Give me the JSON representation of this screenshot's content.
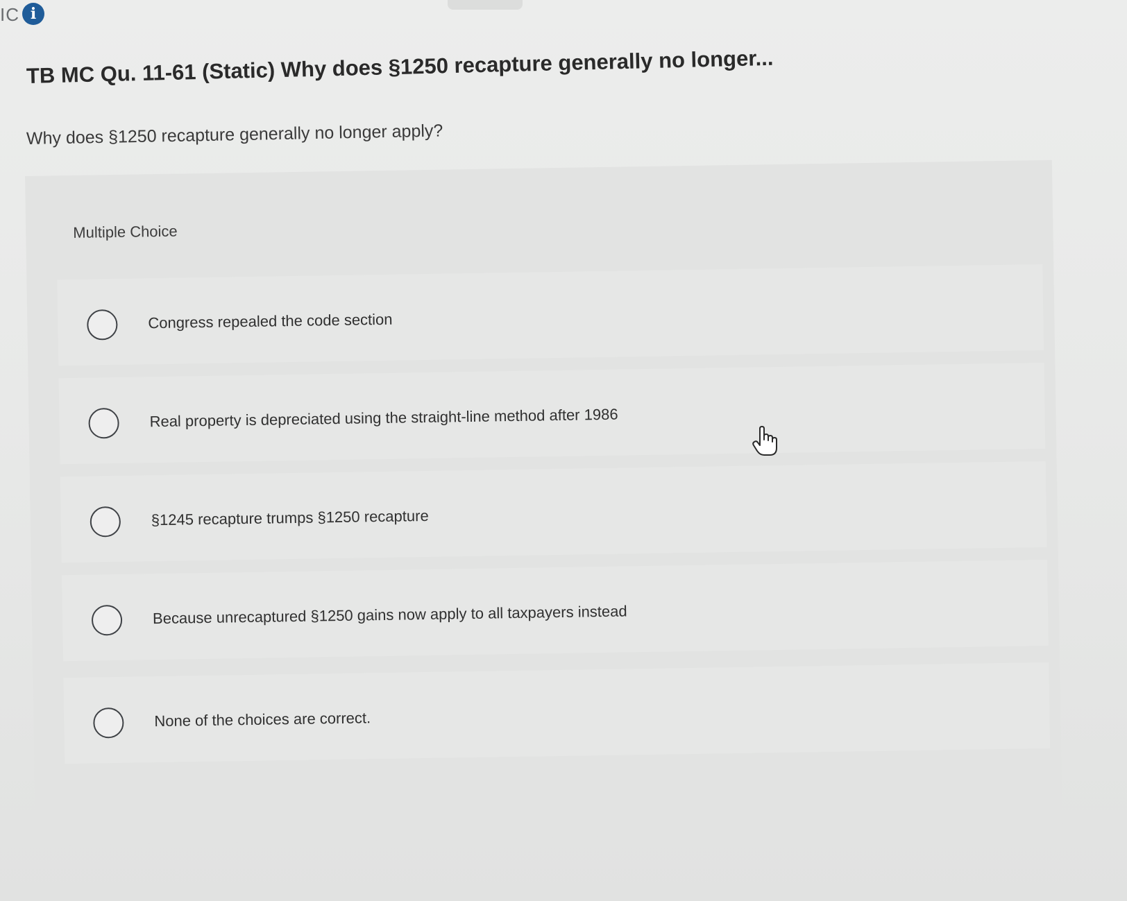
{
  "header": {
    "corner_label": "IC",
    "info_icon": "info-icon"
  },
  "question": {
    "title": "TB MC Qu. 11-61 (Static) Why does §1250 recapture generally no longer...",
    "prompt": "Why does §1250 recapture generally no longer apply?"
  },
  "choices": {
    "section_label": "Multiple Choice",
    "options": [
      {
        "label": "Congress repealed the code section",
        "selected": false
      },
      {
        "label": "Real property is depreciated using the straight-line method after 1986",
        "selected": false
      },
      {
        "label": "§1245 recapture trumps §1250 recapture",
        "selected": false
      },
      {
        "label": "Because unrecaptured §1250 gains now apply to all taxpayers instead",
        "selected": false
      },
      {
        "label": "None of the choices are correct.",
        "selected": false
      }
    ]
  },
  "cursor": {
    "icon": "hand-pointer-icon"
  },
  "colors": {
    "info_icon": "#1f5c99",
    "radio_border": "#3f4246",
    "panel": "#e2e3e2"
  }
}
